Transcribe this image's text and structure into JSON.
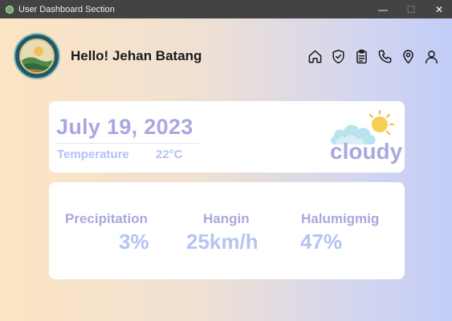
{
  "window": {
    "title": "User Dashboard Section",
    "minimize_glyph": "—",
    "maximize_glyph": "☐",
    "close_glyph": "✕"
  },
  "header": {
    "greeting": "Hello! Jehan Batang",
    "avatar": "logo-emblem",
    "nav_icons": [
      "home-icon",
      "shield-icon",
      "clipboard-icon",
      "phone-icon",
      "location-pin-icon",
      "user-icon"
    ]
  },
  "weather": {
    "date": "July 19, 2023",
    "temperature_label": "Temperature",
    "temperature_value": "22°C",
    "condition": "cloudy",
    "condition_icon": "cloud-sun-icon"
  },
  "stats": [
    {
      "label": "Precipitation",
      "value": "3%"
    },
    {
      "label": "Hangin",
      "value": "25km/h"
    },
    {
      "label": "Halumigmig",
      "value": "47%"
    }
  ],
  "colors": {
    "accent_text": "#a8a8e0",
    "accent_light": "#b5c4f4",
    "gradient_left": "#fde5c3",
    "gradient_right": "#c1ccf7",
    "titlebar": "#434343"
  }
}
